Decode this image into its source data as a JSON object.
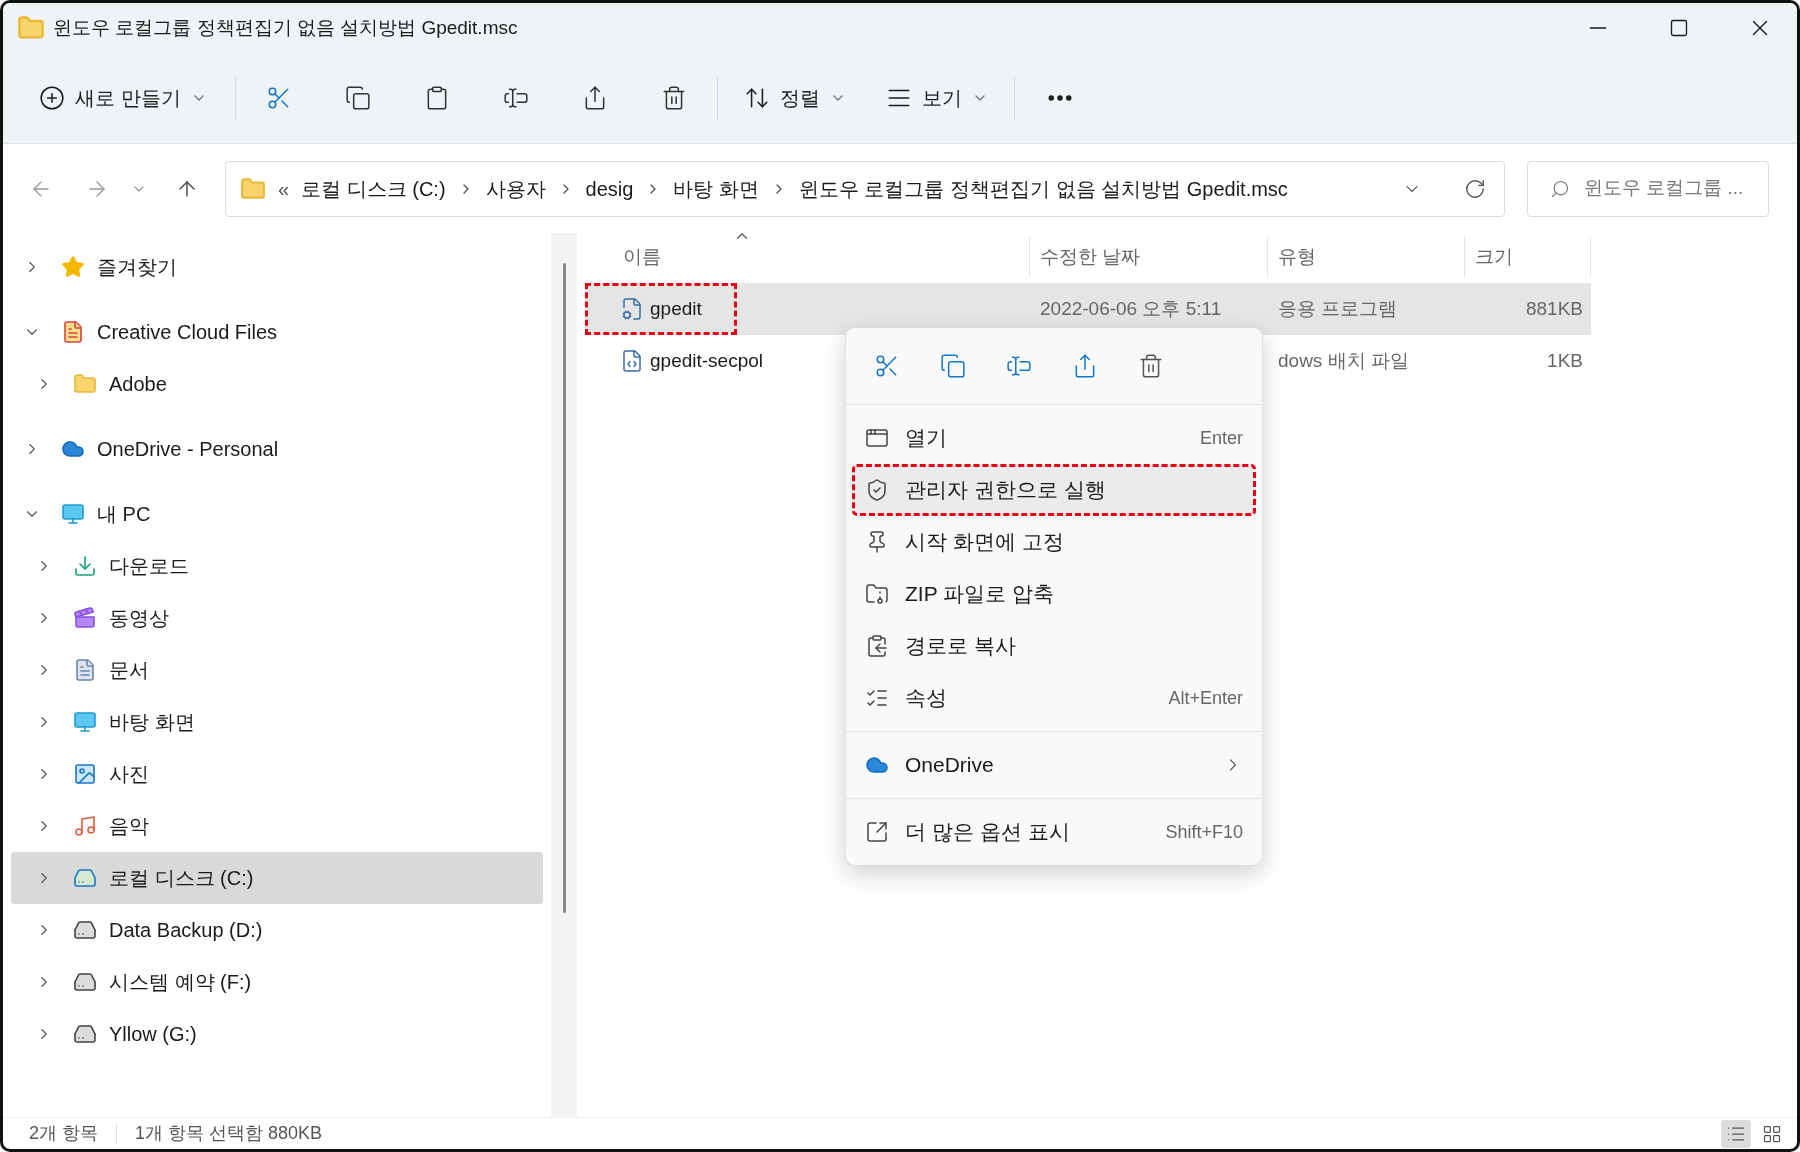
{
  "window": {
    "title": "윈도우 로컬그룹 정책편집기 없음 설치방법 Gpedit.msc"
  },
  "toolbar": {
    "new_label": "새로 만들기",
    "sort_label": "정렬",
    "view_label": "보기"
  },
  "address": {
    "overflow": "«",
    "crumbs": [
      "로컬 디스크 (C:)",
      "사용자",
      "desig",
      "바탕 화면",
      "윈도우 로컬그룹 정책편집기 없음 설치방법 Gpedit.msc"
    ]
  },
  "search": {
    "placeholder": "윈도우 로컬그룹 ..."
  },
  "sidebar": {
    "items": [
      {
        "label": "즐겨찾기",
        "kind": "favorites",
        "expanded": false,
        "selected": false
      },
      {
        "label": "Creative Cloud Files",
        "kind": "cloud_files",
        "expanded": true,
        "selected": false,
        "children": [
          {
            "label": "Adobe",
            "kind": "folder",
            "expanded": false,
            "selected": false
          }
        ]
      },
      {
        "label": "OneDrive - Personal",
        "kind": "onedrive",
        "expanded": false,
        "selected": false
      },
      {
        "label": "내 PC",
        "kind": "pc",
        "expanded": true,
        "selected": false,
        "children": [
          {
            "label": "다운로드",
            "kind": "downloads",
            "expanded": false,
            "selected": false
          },
          {
            "label": "동영상",
            "kind": "videos",
            "expanded": false,
            "selected": false
          },
          {
            "label": "문서",
            "kind": "documents",
            "expanded": false,
            "selected": false
          },
          {
            "label": "바탕 화면",
            "kind": "desktop",
            "expanded": false,
            "selected": false
          },
          {
            "label": "사진",
            "kind": "pictures",
            "expanded": false,
            "selected": false
          },
          {
            "label": "음악",
            "kind": "music",
            "expanded": false,
            "selected": false
          },
          {
            "label": "로컬 디스크 (C:)",
            "kind": "system_drive",
            "expanded": false,
            "selected": true
          },
          {
            "label": "Data Backup (D:)",
            "kind": "drive",
            "expanded": false,
            "selected": false
          },
          {
            "label": "시스템 예약 (F:)",
            "kind": "drive",
            "expanded": false,
            "selected": false
          },
          {
            "label": "Yllow (G:)",
            "kind": "drive",
            "expanded": false,
            "selected": false
          }
        ]
      }
    ]
  },
  "columns": [
    {
      "label": "이름",
      "sorted": true
    },
    {
      "label": "수정한 날짜",
      "sorted": false
    },
    {
      "label": "유형",
      "sorted": false
    },
    {
      "label": "크기",
      "sorted": false
    }
  ],
  "files": [
    {
      "name": "gpedit",
      "kind": "app",
      "date": "2022-06-06 오후 5:11",
      "type": "응용 프로그램",
      "size": "881KB",
      "selected": true,
      "annotated": true
    },
    {
      "name": "gpedit-secpol",
      "kind": "script",
      "type": "dows 배치 파일",
      "size": "1KB",
      "selected": false,
      "annotated": false
    }
  ],
  "context_menu": {
    "groups": [
      {
        "items": [
          {
            "label": "열기",
            "shortcut": "Enter",
            "kind": "item",
            "selected": false,
            "annotated": false
          },
          {
            "label": "관리자 권한으로 실행",
            "kind": "item",
            "selected": true,
            "annotated": true
          },
          {
            "label": "시작 화면에 고정",
            "kind": "item",
            "selected": false,
            "annotated": false
          },
          {
            "label": "ZIP 파일로 압축",
            "kind": "item",
            "selected": false,
            "annotated": false
          },
          {
            "label": "경로로 복사",
            "kind": "item",
            "selected": false,
            "annotated": false
          },
          {
            "label": "속성",
            "shortcut": "Alt+Enter",
            "kind": "item",
            "selected": false,
            "annotated": false
          }
        ]
      },
      {
        "items": [
          {
            "label": "OneDrive",
            "kind": "submenu",
            "selected": false,
            "annotated": false
          }
        ]
      },
      {
        "items": [
          {
            "label": "더 많은 옵션 표시",
            "shortcut": "Shift+F10",
            "kind": "item",
            "selected": false,
            "annotated": false
          }
        ]
      }
    ]
  },
  "status_bar": {
    "item_count": "2개 항목",
    "selection": "1개 항목 선택함 880KB",
    "view_modes": [
      {
        "selected": true
      },
      {
        "selected": false
      }
    ]
  }
}
